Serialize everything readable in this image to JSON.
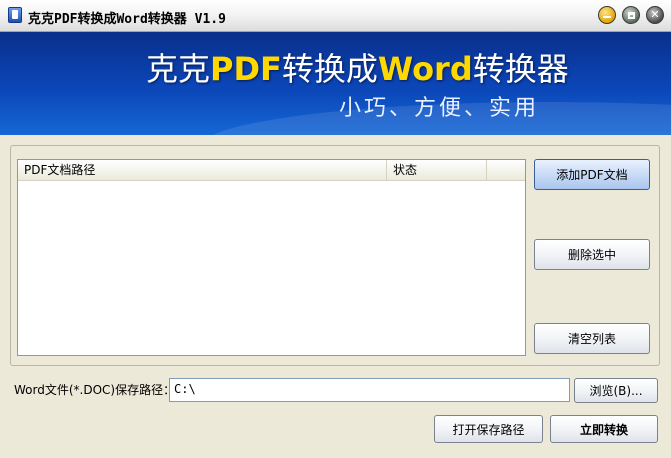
{
  "window": {
    "title": "克克PDF转换成Word转换器 V1.9"
  },
  "banner": {
    "title_part1": "克克",
    "title_part2": "PDF",
    "title_part3": "转换成",
    "title_part4": "Word",
    "title_part5": "转换器",
    "subtitle": "小巧、方便、实用"
  },
  "list": {
    "columns": [
      "PDF文档路径",
      "状态"
    ],
    "rows": []
  },
  "buttons": {
    "add": "添加PDF文档",
    "delete": "删除选中",
    "clear": "清空列表",
    "browse": "浏览(B)...",
    "open_path": "打开保存路径",
    "convert": "立即转换"
  },
  "save": {
    "label": "Word文件(*.DOC)保存路径：",
    "value": "C:\\"
  },
  "colors": {
    "banner_blue": "#0b46b8",
    "banner_highlight": "#ffd800"
  }
}
